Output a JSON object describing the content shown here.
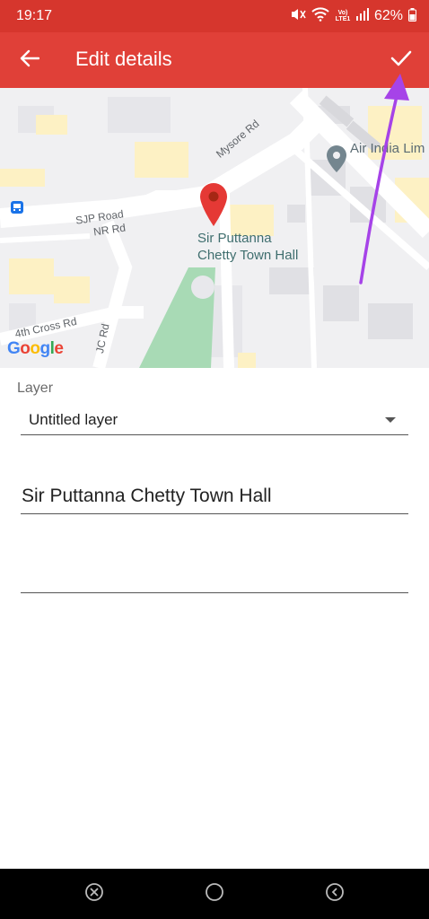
{
  "status_bar": {
    "time": "19:17",
    "network": "Vo) LTE1",
    "battery": "62%"
  },
  "app_bar": {
    "title": "Edit details",
    "back_icon": "arrow-left-icon",
    "confirm_icon": "check-icon"
  },
  "map": {
    "roads": [
      "Mysore Rd",
      "SJP Road",
      "NR Rd",
      "4th Cross Rd",
      "JC Rd"
    ],
    "poi": "Air India Lim",
    "place_label_line1": "Sir Puttanna",
    "place_label_line2": "Chetty Town Hall",
    "logo": {
      "g": "G",
      "o1": "o",
      "o2": "o",
      "g2": "g",
      "l": "l",
      "e": "e"
    },
    "colors": {
      "background": "#f0f0f2",
      "roads": "#ffffff",
      "park": "#a8dab5",
      "building": "#fdf1c4",
      "pin": "#e53935"
    }
  },
  "form": {
    "layer_label": "Layer",
    "layer_value": "Untitled layer",
    "name_value": "Sir Puttanna Chetty Town Hall",
    "description_value": ""
  },
  "colors": {
    "app_bar": "#e04038",
    "status_bar": "#d6362d",
    "annotation_arrow": "#a643e8"
  },
  "nav_bar": {
    "icons": [
      "close-circle-icon",
      "home-circle-icon",
      "back-circle-icon"
    ]
  }
}
